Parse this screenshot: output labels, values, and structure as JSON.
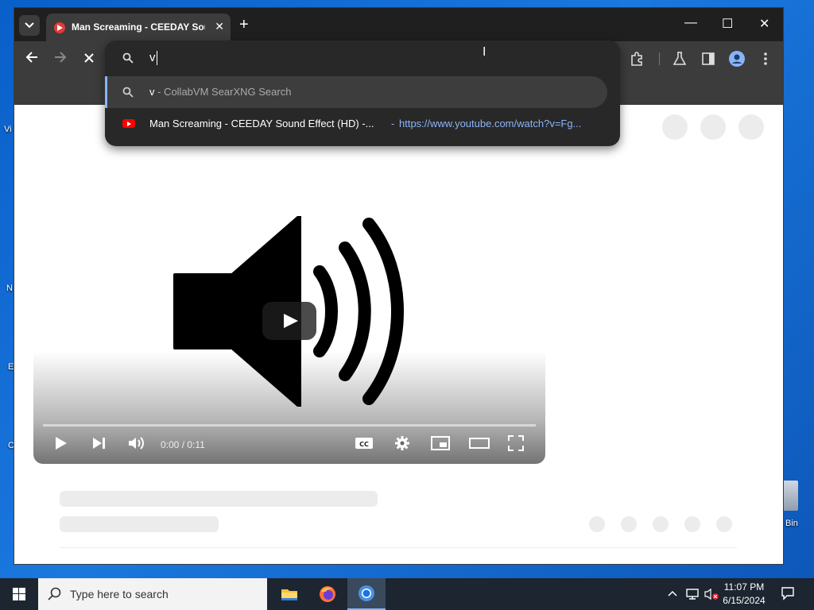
{
  "browser": {
    "tab": {
      "title": "Man Screaming - CEEDAY Sound Effect (HD)"
    },
    "new_tab_symbol": "+",
    "window_controls": {
      "minimize": "—",
      "maximize": "☐",
      "close": "✕"
    }
  },
  "omnibox": {
    "typed_text": "v",
    "suggestions": [
      {
        "query": "v",
        "suffix": " - CollabVM SearXNG Search",
        "icon": "search-icon"
      },
      {
        "title": "Man Screaming - CEEDAY Sound Effect (HD) -...",
        "separator": "-",
        "url": "https://www.youtube.com/watch?v=Fg...",
        "icon": "youtube-icon"
      }
    ]
  },
  "video": {
    "time": "0:00 / 0:11"
  },
  "desktop": {
    "recycle_bin_label": "Bin",
    "left_labels": [
      "Vi",
      "N",
      "E",
      "C"
    ]
  },
  "taskbar": {
    "search_placeholder": "Type here to search",
    "clock_time": "11:07 PM",
    "clock_date": "6/15/2024"
  },
  "colors": {
    "accent": "#8ab4f8",
    "youtube_red": "#ff0000",
    "titlebar": "#1f1f1f"
  }
}
